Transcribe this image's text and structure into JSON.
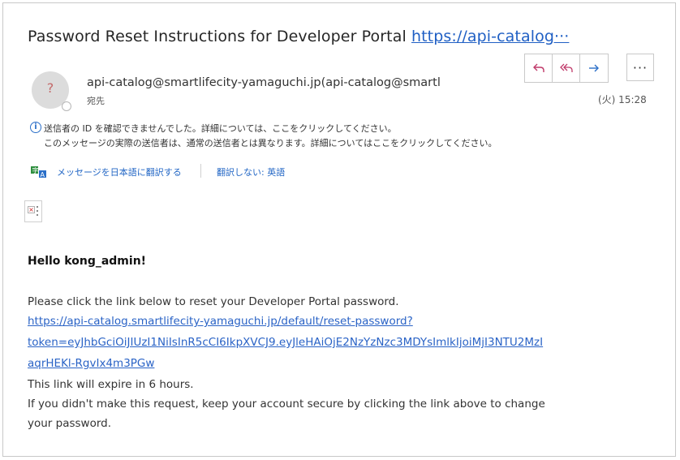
{
  "email": {
    "subject_text": "Password Reset Instructions for Developer Portal",
    "subject_link": "https://api-catalog···",
    "avatar_initial": "?",
    "sender": "api-catalog@smartlifecity-yamaguchi.jp(api-catalog@smartl",
    "to_label": "宛先",
    "timestamp": "(火) 15:28",
    "warning_line1": "送信者の ID を確認できませんでした。詳細については、ここをクリックしてください。",
    "warning_line2": "このメッセージの実際の送信者は、通常の送信者とは異なります。詳細についてはここをクリックしてください。",
    "translate_label": "メッセージを日本語に翻訳する",
    "no_translate_label": "翻訳しない: 英語"
  },
  "toolbar": {
    "reply_icon": "reply-icon",
    "reply_all_icon": "reply-all-icon",
    "forward_icon": "forward-icon",
    "more_label": "···"
  },
  "body": {
    "greeting": "Hello kong_admin!",
    "instruction": "Please click the link below to reset your Developer Portal password.",
    "link_line1": "https://api-catalog.smartlifecity-yamaguchi.jp/default/reset-password?",
    "link_line2": "token=eyJhbGciOiJIUzI1NiIsInR5cCI6IkpXVCJ9.eyJleHAiOjE2NzYzNzc3MDYsImlkIjoiMjI3NTU2MzI",
    "link_line3": "aqrHEKl-RgvIx4m3PGw",
    "expire_note": "This link will expire in 6 hours.",
    "ignore_note_line1": "If you didn't make this request, keep your account secure by clicking the link above to change",
    "ignore_note_line2": "your password."
  },
  "colors": {
    "link": "#2a63c6",
    "accent": "#2b6fc8"
  }
}
